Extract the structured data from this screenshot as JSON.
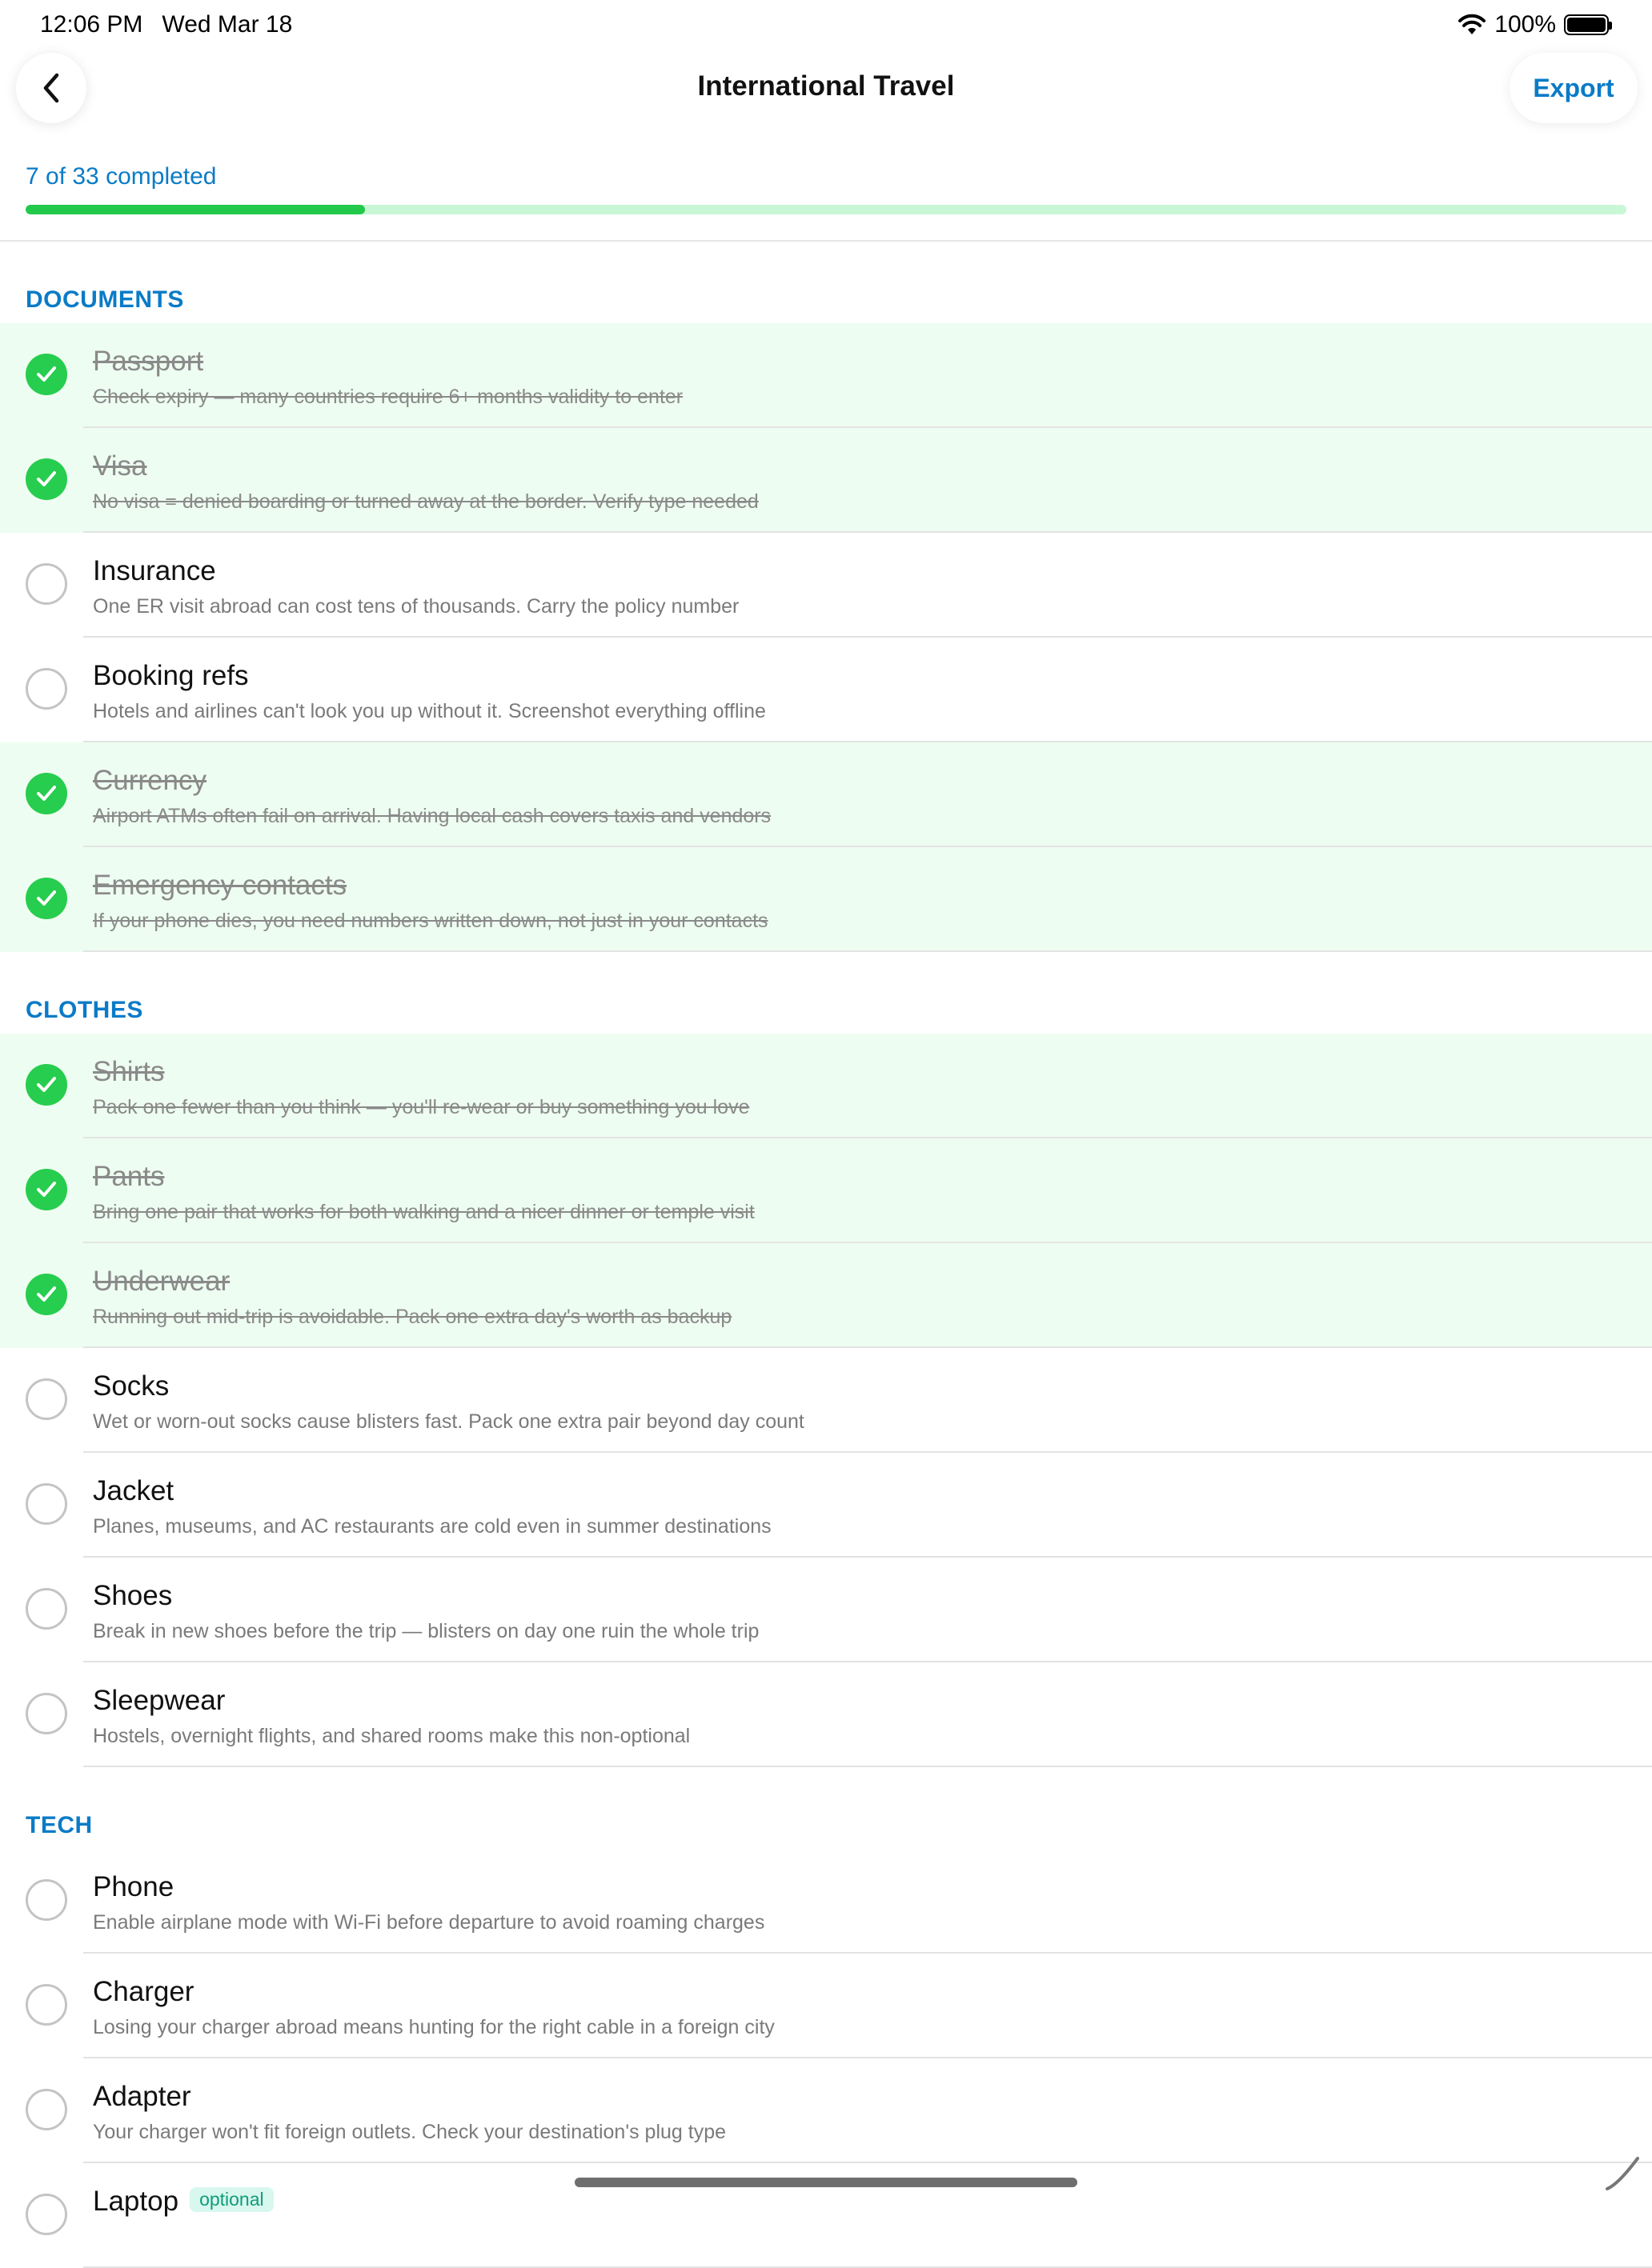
{
  "status_bar": {
    "time": "12:06 PM",
    "date": "Wed Mar 18",
    "battery": "100%"
  },
  "nav": {
    "title": "International Travel",
    "export_label": "Export",
    "back_icon": "chevron-left-icon"
  },
  "progress": {
    "label": "7 of 33 completed",
    "completed": 7,
    "total": 33
  },
  "colors": {
    "accent": "#0a7bc7",
    "check_green": "#27cd4e",
    "checked_row_bg": "#eefdf1",
    "progress_track": "#c9f7d6"
  },
  "sections": [
    {
      "title": "DOCUMENTS",
      "items": [
        {
          "title": "Passport",
          "desc": "Check expiry — many countries require 6+ months validity to enter",
          "checked": true
        },
        {
          "title": "Visa",
          "desc": "No visa = denied boarding or turned away at the border. Verify type needed",
          "checked": true
        },
        {
          "title": "Insurance",
          "desc": "One ER visit abroad can cost tens of thousands. Carry the policy number",
          "checked": false
        },
        {
          "title": "Booking refs",
          "desc": "Hotels and airlines can't look you up without it. Screenshot everything offline",
          "checked": false
        },
        {
          "title": "Currency",
          "desc": "Airport ATMs often fail on arrival. Having local cash covers taxis and vendors",
          "checked": true
        },
        {
          "title": "Emergency contacts",
          "desc": "If your phone dies, you need numbers written down, not just in your contacts",
          "checked": true
        }
      ]
    },
    {
      "title": "CLOTHES",
      "items": [
        {
          "title": "Shirts",
          "desc": "Pack one fewer than you think — you'll re-wear or buy something you love",
          "checked": true
        },
        {
          "title": "Pants",
          "desc": "Bring one pair that works for both walking and a nicer dinner or temple visit",
          "checked": true
        },
        {
          "title": "Underwear",
          "desc": "Running out mid-trip is avoidable. Pack one extra day's worth as backup",
          "checked": true
        },
        {
          "title": "Socks",
          "desc": "Wet or worn-out socks cause blisters fast. Pack one extra pair beyond day count",
          "checked": false
        },
        {
          "title": "Jacket",
          "desc": "Planes, museums, and AC restaurants are cold even in summer destinations",
          "checked": false
        },
        {
          "title": "Shoes",
          "desc": "Break in new shoes before the trip — blisters on day one ruin the whole trip",
          "checked": false
        },
        {
          "title": "Sleepwear",
          "desc": "Hostels, overnight flights, and shared rooms make this non-optional",
          "checked": false
        }
      ]
    },
    {
      "title": "TECH",
      "items": [
        {
          "title": "Phone",
          "desc": "Enable airplane mode with Wi-Fi before departure to avoid roaming charges",
          "checked": false
        },
        {
          "title": "Charger",
          "desc": "Losing your charger abroad means hunting for the right cable in a foreign city",
          "checked": false
        },
        {
          "title": "Adapter",
          "desc": "Your charger won't fit foreign outlets. Check your destination's plug type",
          "checked": false
        },
        {
          "title": "Laptop",
          "badge": "optional",
          "desc": "",
          "checked": false
        }
      ]
    }
  ]
}
